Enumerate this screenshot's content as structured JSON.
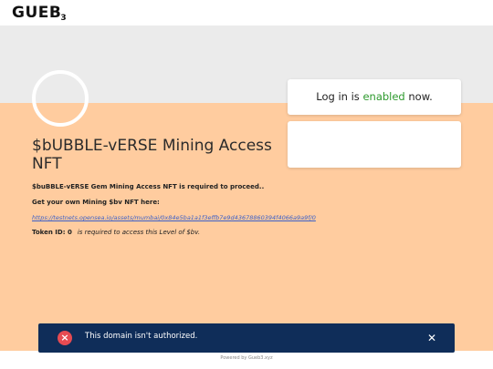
{
  "header": {
    "logo_main": "GUEB",
    "logo_sub": "3"
  },
  "hero": {
    "title": "$bUBBLE-vERSE Mining Access NFT"
  },
  "content": {
    "requirement_text": "$buBBLE-vERSE Gem Mining Access NFT is required to proceed..",
    "get_text": "Get your own Mining $bv NFT here:",
    "link_text": "https://testnets.opensea.io/assets/mumbai/0x84e5ba1a1f3effb7e9d43678860394f4066a9a9f/0",
    "token_label": "Token ID: 0",
    "token_note": "is required to access this Level of $bv."
  },
  "login_card": {
    "prefix": "Log in is ",
    "status": "enabled",
    "suffix": " now."
  },
  "toast": {
    "icon": "×",
    "message": "This domain isn't authorized.",
    "close": "✕"
  },
  "footer": {
    "text": "Powered by Gueb3.xyz"
  },
  "colors": {
    "peach": "#ffcc9f",
    "toast_bg": "#0f2d59",
    "enabled_green": "#2e9a2e",
    "error_red": "#e64b52"
  }
}
